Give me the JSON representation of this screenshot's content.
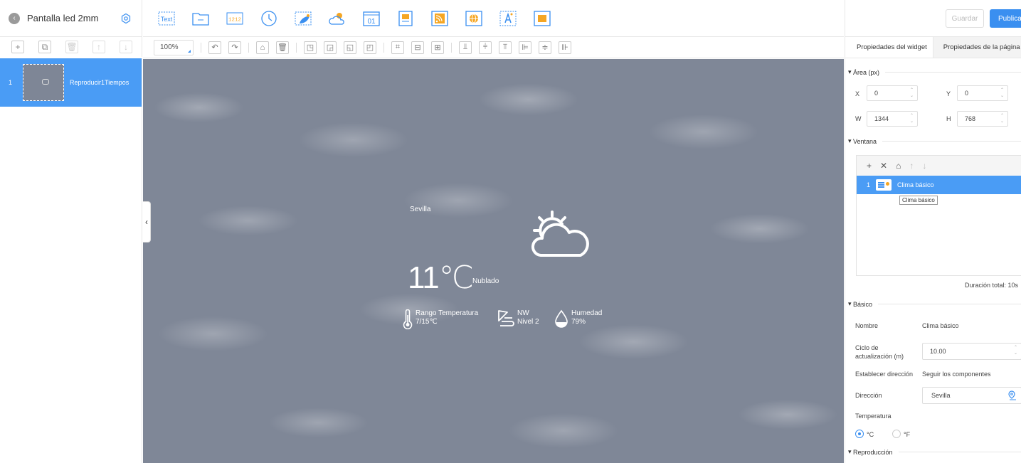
{
  "header": {
    "title": "Pantalla led 2mm",
    "save_label": "Guardar",
    "publish_label": "Publicar"
  },
  "widgets": {
    "text_label": "Text",
    "counter_label": "1212",
    "calendar_label": "01"
  },
  "edit": {
    "zoom": "100%"
  },
  "pages": [
    {
      "num": "1",
      "name": "Reproducir1Tiempos"
    }
  ],
  "weather": {
    "city": "Sevilla",
    "temperature": "11℃",
    "condition": "Nublado",
    "range_label": "Rango Temperatura",
    "range_value": "7/15℃",
    "wind_dir": "NW",
    "wind_level": "Nivel 2",
    "humidity_label": "Humedad",
    "humidity_value": "79%"
  },
  "panel": {
    "tab_widget": "Propiedades del widget",
    "tab_page": "Propiedades de la página",
    "area_title": "Área (px)",
    "x_label": "X",
    "x_value": "0",
    "y_label": "Y",
    "y_value": "0",
    "w_label": "W",
    "w_value": "1344",
    "h_label": "H",
    "h_value": "768",
    "window_title": "Ventana",
    "window_item_num": "1",
    "window_item_name": "Clima básico",
    "tooltip": "Clima básico",
    "duration": "Duración total: 10s",
    "basic_title": "Básico",
    "name_label": "Nombre",
    "name_value": "Clima básico",
    "cycle_label": "Ciclo de actualización (m)",
    "cycle_value": "10.00",
    "direction_set_label": "Establecer dirección",
    "direction_set_value": "Seguir los componentes",
    "address_label": "Dirección",
    "address_value": "Sevilla",
    "temperature_label": "Temperatura",
    "unit_c": "°C",
    "unit_f": "°F",
    "playback_title": "Reproducción"
  },
  "colors": {
    "accent": "#3a8ff0",
    "selected": "#4a9cf5",
    "canvas": "#7f8797"
  }
}
